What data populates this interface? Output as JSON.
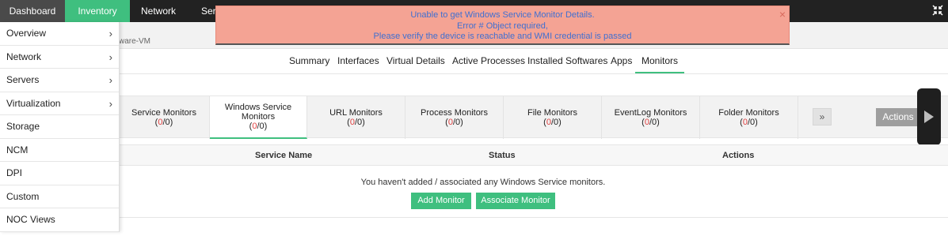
{
  "topnav": {
    "tabs": [
      {
        "label": "Dashboard"
      },
      {
        "label": "Inventory"
      },
      {
        "label": "Network"
      },
      {
        "label": "Servers"
      }
    ],
    "collapse_icon": "collapse-arrows-icon"
  },
  "error": {
    "line1": "Unable to get Windows Service Monitor Details.",
    "line2": "Error #  Object required,",
    "line3": "Please verify the device is reachable and WMI credential is passed",
    "close": "×"
  },
  "breadcrumb": {
    "device": "ware-VM"
  },
  "device_tabs": [
    {
      "label": "Summary"
    },
    {
      "label": "Interfaces"
    },
    {
      "label": "Virtual Details"
    },
    {
      "label": "Active Processes"
    },
    {
      "label": "Installed Softwares"
    },
    {
      "label": "Apps"
    },
    {
      "label": "Monitors"
    }
  ],
  "monitors": [
    {
      "label": "Service Monitors",
      "open": "(",
      "count_a": "0",
      "sep": "/",
      "count_b": "0",
      "close": ")"
    },
    {
      "label": "Windows Service Monitors",
      "open": "(",
      "count_a": "0",
      "sep": "/",
      "count_b": "0",
      "close": ")"
    },
    {
      "label": "URL Monitors",
      "open": "(",
      "count_a": "0",
      "sep": "/",
      "count_b": "0",
      "close": ")"
    },
    {
      "label": "Process Monitors",
      "open": "(",
      "count_a": "0",
      "sep": "/",
      "count_b": "0",
      "close": ")"
    },
    {
      "label": "File Monitors",
      "open": "(",
      "count_a": "0",
      "sep": "/",
      "count_b": "0",
      "close": ")"
    },
    {
      "label": "EventLog Monitors",
      "open": "(",
      "count_a": "0",
      "sep": "/",
      "count_b": "0",
      "close": ")"
    },
    {
      "label": "Folder Monitors",
      "open": "(",
      "count_a": "0",
      "sep": "/",
      "count_b": "0",
      "close": ")"
    }
  ],
  "strip": {
    "more_glyph": "»",
    "actions_label": "Actions"
  },
  "table": {
    "columns": [
      "Service Name",
      "Status",
      "Actions"
    ],
    "empty_message": "You haven't added / associated any Windows Service monitors.",
    "add_button": "Add Monitor",
    "associate_button": "Associate Monitor"
  },
  "menu": {
    "items": [
      {
        "label": "Overview",
        "chevron": "›"
      },
      {
        "label": "Network",
        "chevron": "›"
      },
      {
        "label": "Servers",
        "chevron": "›"
      },
      {
        "label": "Virtualization",
        "chevron": "›"
      },
      {
        "label": "Storage",
        "chevron": ""
      },
      {
        "label": "NCM",
        "chevron": ""
      },
      {
        "label": "DPI",
        "chevron": ""
      },
      {
        "label": "Custom",
        "chevron": ""
      },
      {
        "label": "NOC Views",
        "chevron": ""
      }
    ]
  },
  "colors": {
    "accent": "#3fbf7f",
    "error_bg": "#f4a394",
    "error_text": "#3f6fd1"
  }
}
